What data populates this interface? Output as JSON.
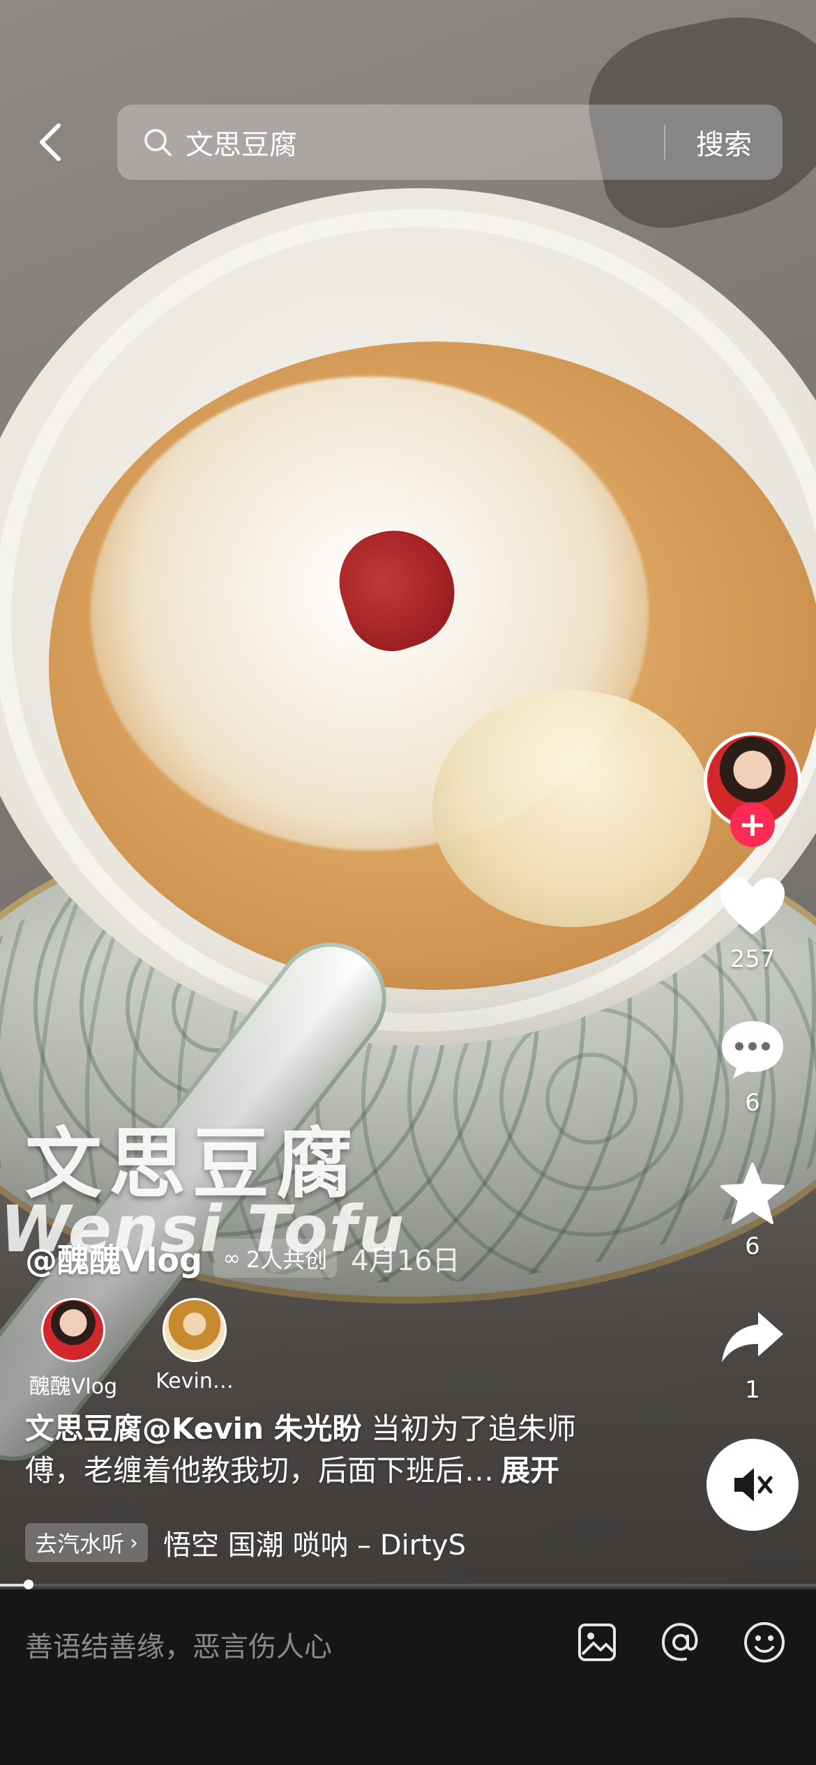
{
  "search": {
    "query": "文思豆腐",
    "button_label": "搜索"
  },
  "overlay": {
    "title_cn": "文思豆腐",
    "title_en": "Wensi Tofu"
  },
  "author": {
    "name": "@醜醜Vlog",
    "coop_label": "2人共创",
    "date": "4月16日"
  },
  "coauthors": [
    {
      "name": "醜醜Vlog"
    },
    {
      "name": "Kevin…"
    }
  ],
  "caption": {
    "bold": "文思豆腐@Kevin 朱光盼",
    "text": " 当初为了追朱师傅，老缠着他教我切，后面下班后…",
    "expand": "展开"
  },
  "music": {
    "button_label": "去汽水听",
    "track": "悟空 国潮 唢呐 – DirtyS"
  },
  "progress": {
    "fraction": 0.035
  },
  "actions": {
    "likes": "257",
    "comments": "6",
    "favorites": "6",
    "shares": "1"
  },
  "comment_bar": {
    "placeholder": "善语结善缘，恶言伤人心"
  },
  "colors": {
    "follow_accent": "#fe2c55",
    "comment_bar_bg": "#161616"
  },
  "icons": {
    "back": "chevron-left-icon",
    "search": "search-icon",
    "like": "heart-icon",
    "comment": "comment-bubble-icon",
    "favorite": "star-icon",
    "share": "share-arrow-icon",
    "mute": "speaker-muted-icon",
    "image": "image-icon",
    "mention": "at-icon",
    "emoji": "smiley-icon"
  }
}
